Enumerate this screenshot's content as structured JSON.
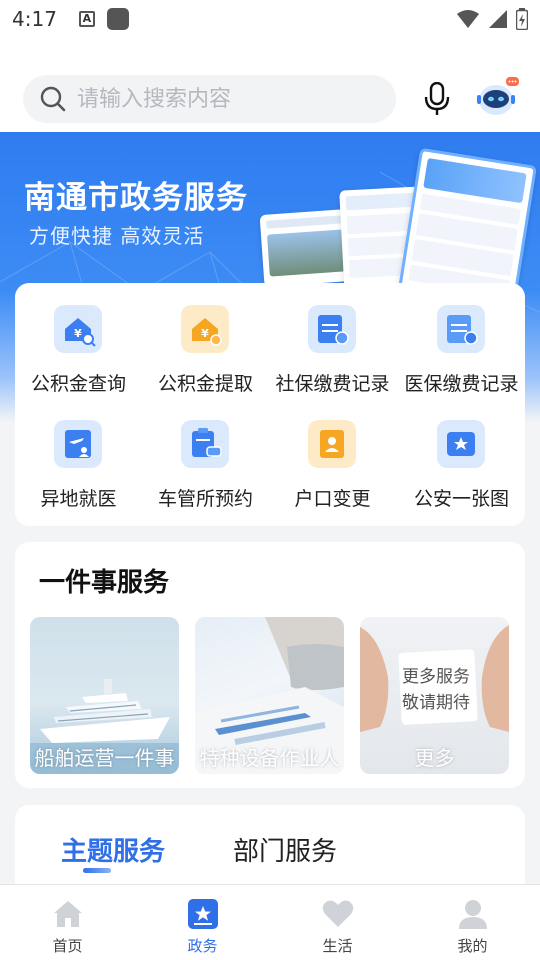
{
  "status_bar": {
    "time": "4:17",
    "notification_letter": "A"
  },
  "search": {
    "placeholder": "请输入搜索内容"
  },
  "banner": {
    "title": "南通市政务服务",
    "subtitle": "方便快捷 高效灵活"
  },
  "quick_services": [
    {
      "label": "公积金查询",
      "icon": "house-search-icon",
      "color": "#dbe9fd"
    },
    {
      "label": "公积金提取",
      "icon": "house-money-icon",
      "color": "#fdebc8"
    },
    {
      "label": "社保缴费记录",
      "icon": "social-security-icon",
      "color": "#dbe9fd"
    },
    {
      "label": "医保缴费记录",
      "icon": "medical-insurance-icon",
      "color": "#dbe9fd"
    },
    {
      "label": "异地就医",
      "icon": "plane-card-icon",
      "color": "#dbe9fd"
    },
    {
      "label": "车管所预约",
      "icon": "car-clipboard-icon",
      "color": "#dbe9fd"
    },
    {
      "label": "户口变更",
      "icon": "household-book-icon",
      "color": "#fdebc8"
    },
    {
      "label": "公安一张图",
      "icon": "police-star-icon",
      "color": "#dbe9fd"
    }
  ],
  "one_thing": {
    "title": "一件事服务",
    "tiles": [
      {
        "caption": "船舶运营一件事"
      },
      {
        "caption": "特种设备作业人"
      },
      {
        "caption": "更多",
        "note_line1": "更多服务",
        "note_line2": "敬请期待"
      }
    ]
  },
  "tabs": {
    "active": "主题服务",
    "inactive": "部门服务"
  },
  "bottom_nav": [
    {
      "label": "首页",
      "icon": "home-icon"
    },
    {
      "label": "政务",
      "icon": "government-star-icon"
    },
    {
      "label": "生活",
      "icon": "heart-icon"
    },
    {
      "label": "我的",
      "icon": "person-icon"
    }
  ],
  "colors": {
    "accent": "#2f6fe8",
    "banner": "#2f7cf0"
  }
}
